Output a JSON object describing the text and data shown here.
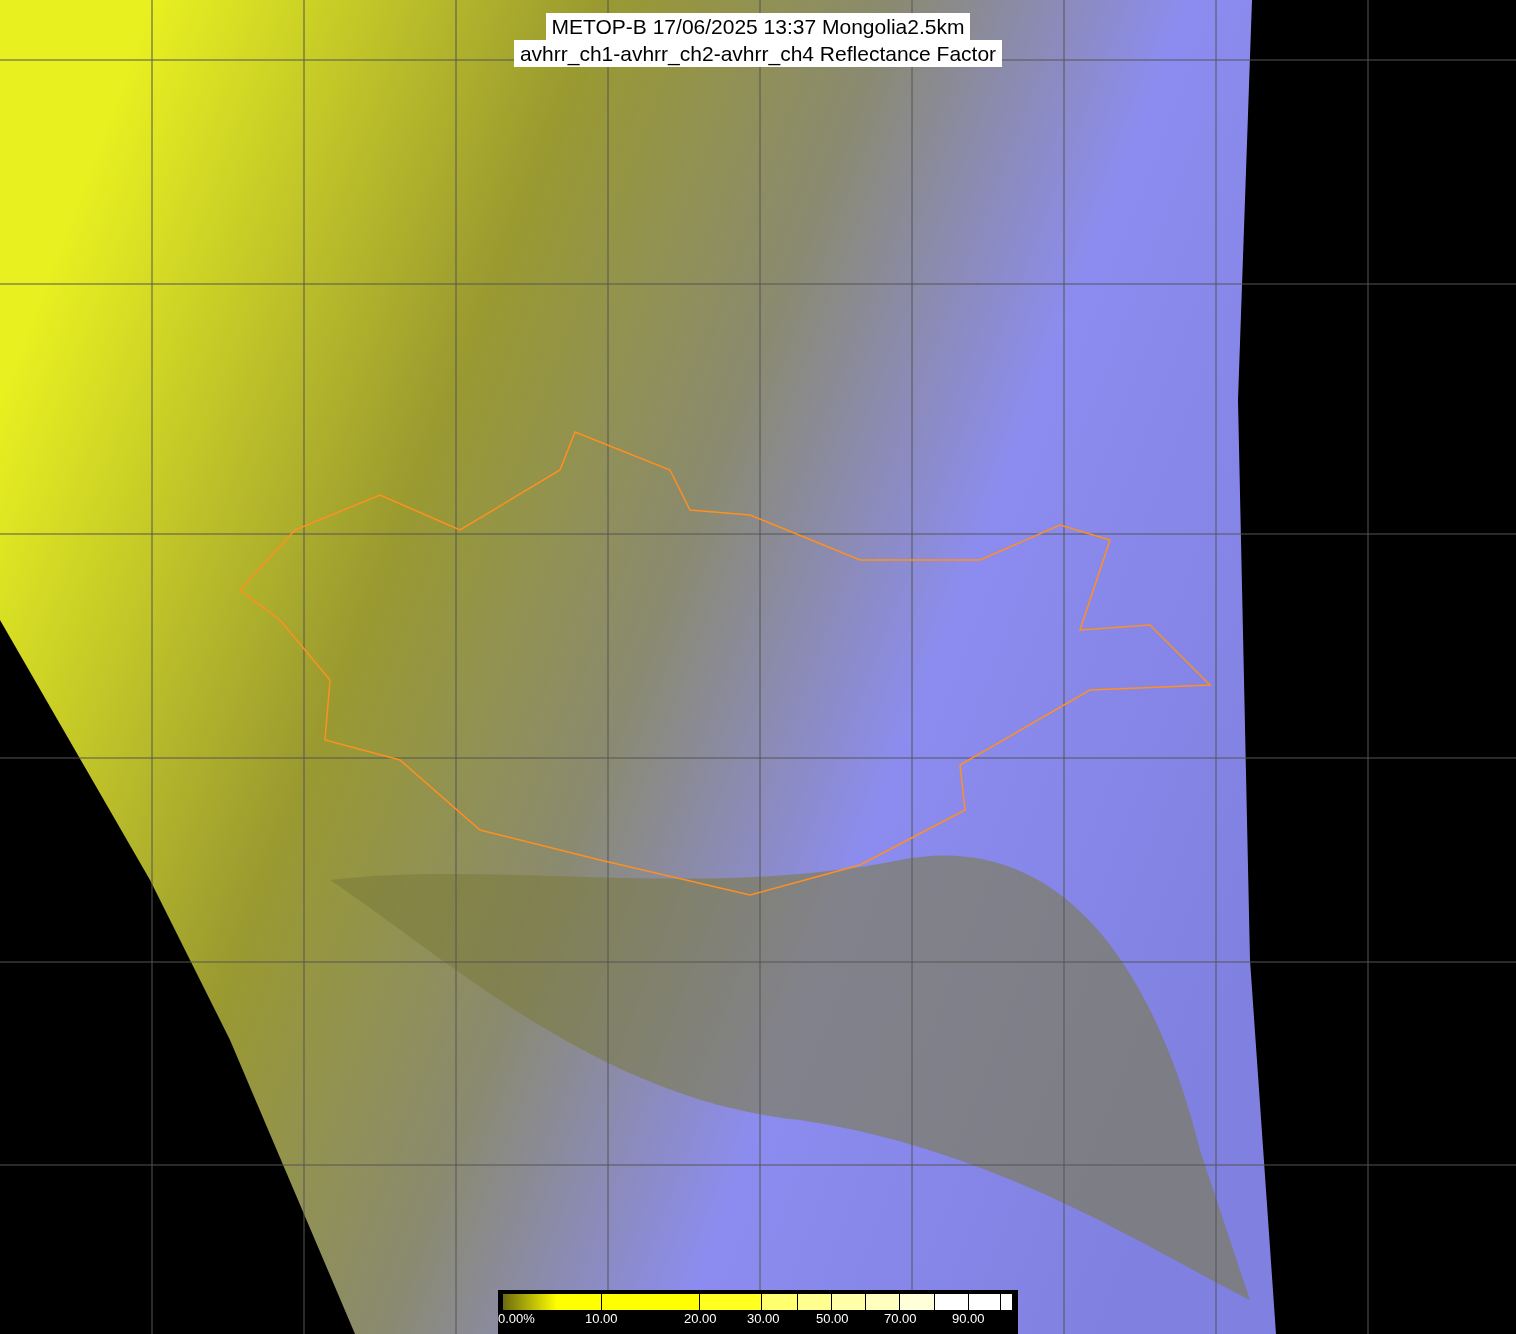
{
  "title": {
    "lines": [
      "METOP-B 17/06/2025 13:37 Mongolia2.5km",
      "avhrr_ch1-avhrr_ch2-avhrr_ch4 Reflectance Factor"
    ]
  },
  "colorbar": {
    "labels": [
      "0.00%",
      "10.00",
      "20.00",
      "30.00",
      "50.00",
      "70.00",
      "90.00"
    ]
  }
}
